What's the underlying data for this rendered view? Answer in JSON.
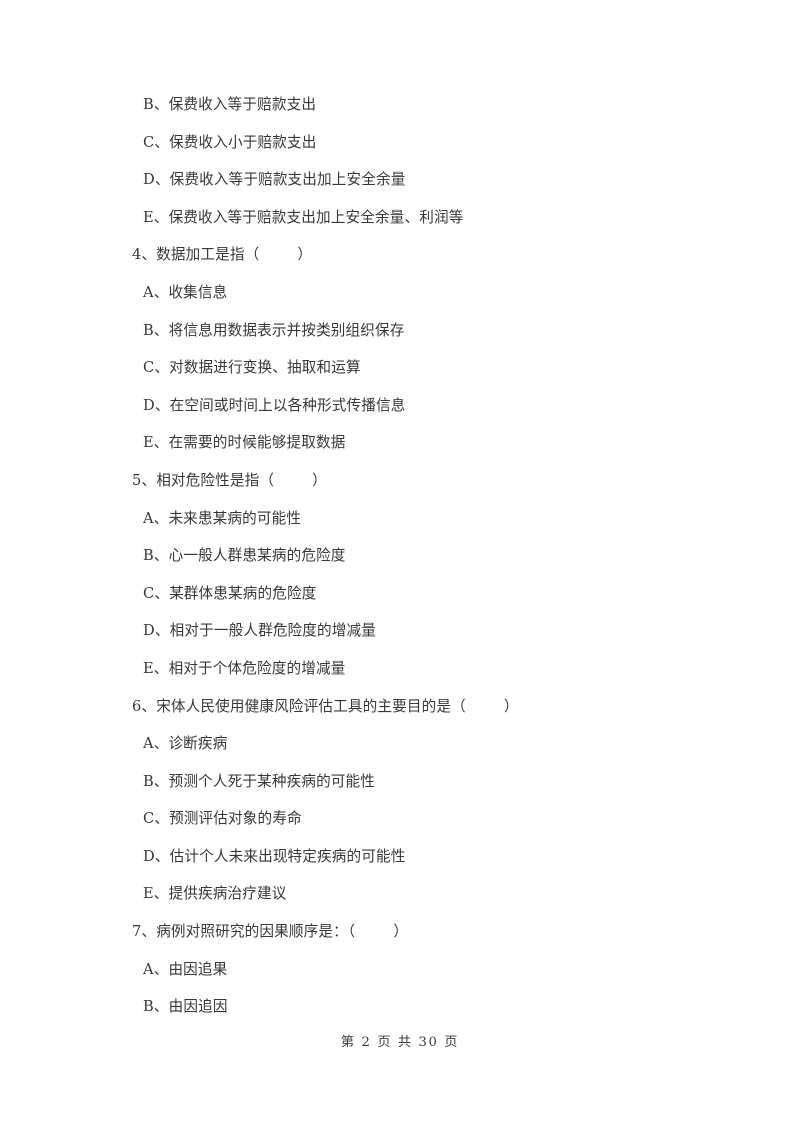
{
  "document": {
    "page_background": "#ffffff",
    "text_color": "#37373a",
    "blank_placeholder": "（      ）"
  },
  "blocks": [
    {
      "type": "options_continued",
      "options": [
        {
          "marker": "B、",
          "text": "保费收入等于赔款支出"
        },
        {
          "marker": "C、",
          "text": "保费收入小于赔款支出"
        },
        {
          "marker": "D、",
          "text": "保费收入等于赔款支出加上安全余量"
        },
        {
          "marker": "E、",
          "text": "保费收入等于赔款支出加上安全余量、利润等"
        }
      ]
    },
    {
      "type": "question",
      "number": "4、",
      "stem": "数据加工是指（",
      "stem_close": "）",
      "options": [
        {
          "marker": "A、",
          "text": "收集信息"
        },
        {
          "marker": "B、",
          "text": "将信息用数据表示并按类别组织保存"
        },
        {
          "marker": "C、",
          "text": "对数据进行变换、抽取和运算"
        },
        {
          "marker": "D、",
          "text": "在空间或时间上以各种形式传播信息"
        },
        {
          "marker": "E、",
          "text": "在需要的时候能够提取数据"
        }
      ]
    },
    {
      "type": "question",
      "number": "5、",
      "stem": "相对危险性是指（",
      "stem_close": "）",
      "options": [
        {
          "marker": "A、",
          "text": "未来患某病的可能性"
        },
        {
          "marker": "B、",
          "text": "心一般人群患某病的危险度"
        },
        {
          "marker": "C、",
          "text": "某群体患某病的危险度"
        },
        {
          "marker": "D、",
          "text": "相对于一般人群危险度的增减量"
        },
        {
          "marker": "E、",
          "text": "相对于个体危险度的增减量"
        }
      ]
    },
    {
      "type": "question",
      "number": "6、",
      "stem": "宋体人民使用健康风险评估工具的主要目的是（",
      "stem_close": "）",
      "options": [
        {
          "marker": "A、",
          "text": "诊断疾病"
        },
        {
          "marker": "B、",
          "text": "预测个人死于某种疾病的可能性"
        },
        {
          "marker": "C、",
          "text": "预测评估对象的寿命"
        },
        {
          "marker": "D、",
          "text": "估计个人未来出现特定疾病的可能性"
        },
        {
          "marker": "E、",
          "text": "提供疾病治疗建议"
        }
      ]
    },
    {
      "type": "question",
      "number": "7、",
      "stem": "病例对照研究的因果顺序是：（",
      "stem_close": "）",
      "options": [
        {
          "marker": "A、",
          "text": "由因追果"
        },
        {
          "marker": "B、",
          "text": "由因追因"
        }
      ]
    }
  ],
  "footer": {
    "prefix": "第",
    "current_page": "2",
    "middle": "页 共",
    "total_pages": "30",
    "suffix": "页",
    "full_text": "第 2 页 共 30 页"
  }
}
